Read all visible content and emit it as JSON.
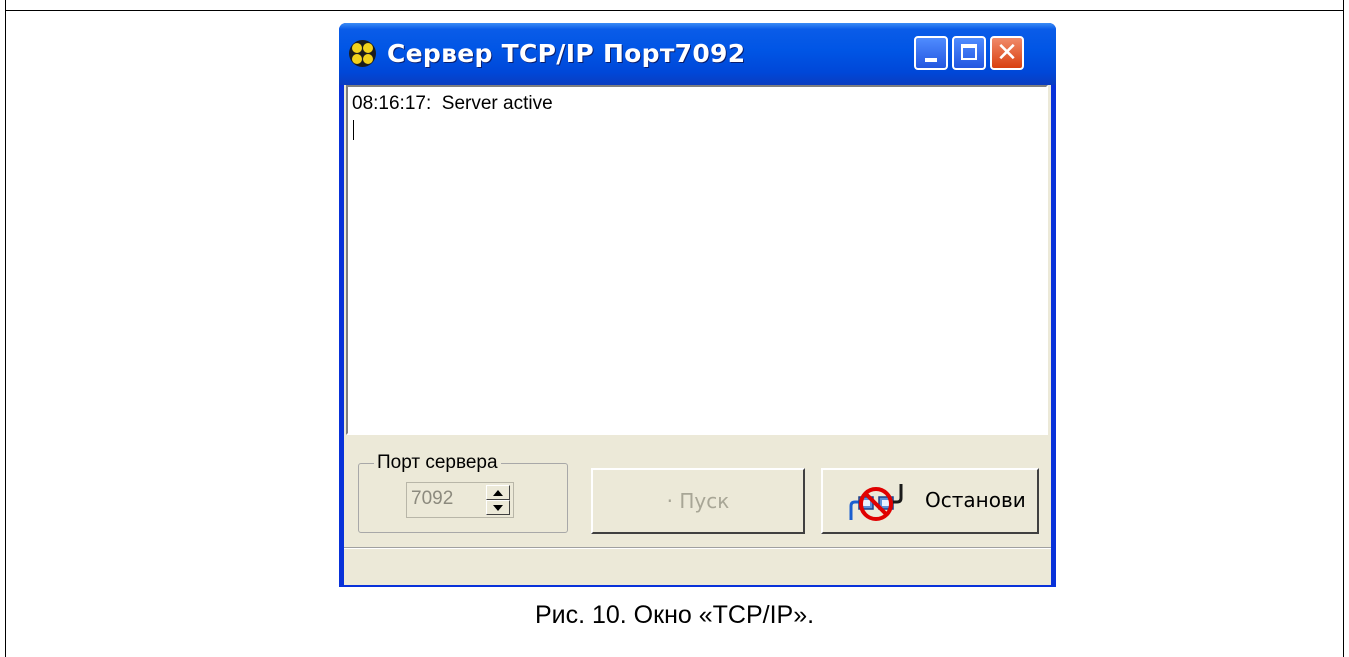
{
  "window": {
    "title": "Сервер TCP/IP  Порт7092",
    "controls": {
      "minimize": "minimize",
      "maximize": "maximize",
      "close": "✕"
    }
  },
  "log": {
    "lines": [
      "08:16:17:  Server active"
    ]
  },
  "port_group": {
    "label": "Порт сервера",
    "port_value": "7092"
  },
  "buttons": {
    "start_label": "· Пуск",
    "stop_label": "Останови"
  },
  "caption": "Рис. 10. Окно «TCP/IP».",
  "colors": {
    "titlebar": "#0055e5",
    "client": "#ece9d8",
    "close_button": "#d9400f",
    "stop_icon_ring": "#e00000"
  }
}
